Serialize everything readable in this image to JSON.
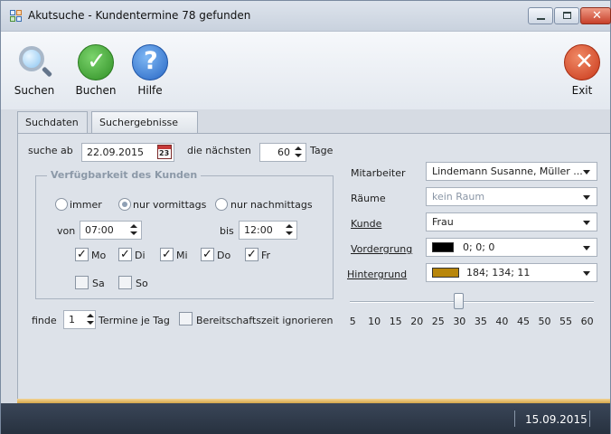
{
  "window": {
    "title": "Akutsuche - Kundentermine 78 gefunden"
  },
  "toolbar": {
    "suchen": "Suchen",
    "buchen": "Buchen",
    "hilfe": "Hilfe",
    "exit": "Exit"
  },
  "tabs": [
    "Suchdaten",
    "Suchergebnisse"
  ],
  "search": {
    "label_ab": "suche ab",
    "date": "22.09.2015",
    "calendar_day": "23",
    "label_naechsten": "die nächsten",
    "days": "60",
    "label_tage": "Tage"
  },
  "availability": {
    "legend": "Verfügbarkeit des Kunden",
    "options": [
      "immer",
      "nur vormittags",
      "nur nachmittags"
    ],
    "selected": "nur vormittags",
    "von_label": "von",
    "von": "07:00",
    "bis_label": "bis",
    "bis": "12:00",
    "days": [
      {
        "label": "Mo",
        "checked": true
      },
      {
        "label": "Di",
        "checked": true
      },
      {
        "label": "Mi",
        "checked": true
      },
      {
        "label": "Do",
        "checked": true
      },
      {
        "label": "Fr",
        "checked": true
      },
      {
        "label": "Sa",
        "checked": false
      },
      {
        "label": "So",
        "checked": false
      }
    ]
  },
  "finde": {
    "label": "finde",
    "value": "1",
    "termine_label": "Termine je Tag",
    "bereitschaft_label": "Bereitschaftszeit ignorieren"
  },
  "right": {
    "mitarbeiter_label": "Mitarbeiter",
    "mitarbeiter_value": "Lindemann Susanne, Müller ...",
    "raeume_label": "Räume",
    "raeume_value": "kein Raum",
    "kunde_label": "Kunde",
    "kunde_value": "Frau",
    "vordergrund_label": "Vordergrung",
    "vordergrund_value": "0; 0; 0",
    "vordergrund_color": "#000000",
    "hintergrund_label": "Hintergrund",
    "hintergrund_value": "184; 134; 11",
    "hintergrund_color": "#b8860b"
  },
  "slider": {
    "value": 30,
    "ticks": [
      "5",
      "10",
      "15",
      "20",
      "25",
      "30",
      "35",
      "40",
      "45",
      "50",
      "55",
      "60"
    ]
  },
  "status": {
    "date": "15.09.2015"
  }
}
